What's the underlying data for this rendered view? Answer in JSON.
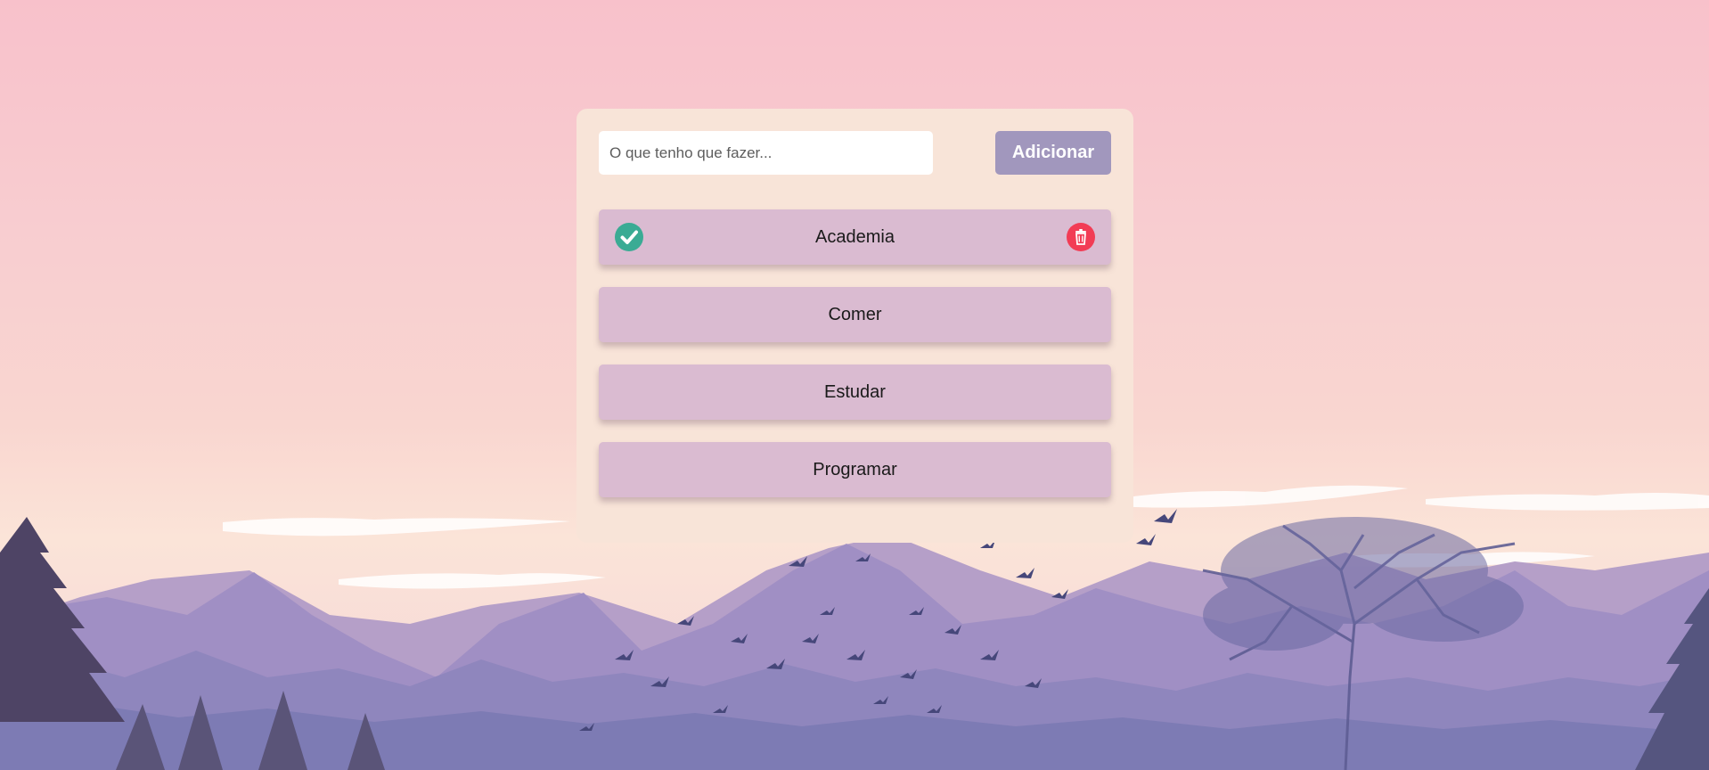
{
  "new_task": {
    "placeholder": "O que tenho que fazer...",
    "value": "",
    "add_label": "Adicionar"
  },
  "tasks": [
    {
      "label": "Academia",
      "completed": true,
      "show_actions": true
    },
    {
      "label": "Comer",
      "completed": false,
      "show_actions": false
    },
    {
      "label": "Estudar",
      "completed": false,
      "show_actions": false
    },
    {
      "label": "Programar",
      "completed": false,
      "show_actions": false
    }
  ],
  "icons": {
    "check": "check-circle-icon",
    "delete": "trash-icon"
  },
  "colors": {
    "card_bg": "#f8e4d8",
    "task_bg": "#dabbd1",
    "button_bg": "#a197bd",
    "check": "#3aab94",
    "delete": "#f23c55"
  }
}
